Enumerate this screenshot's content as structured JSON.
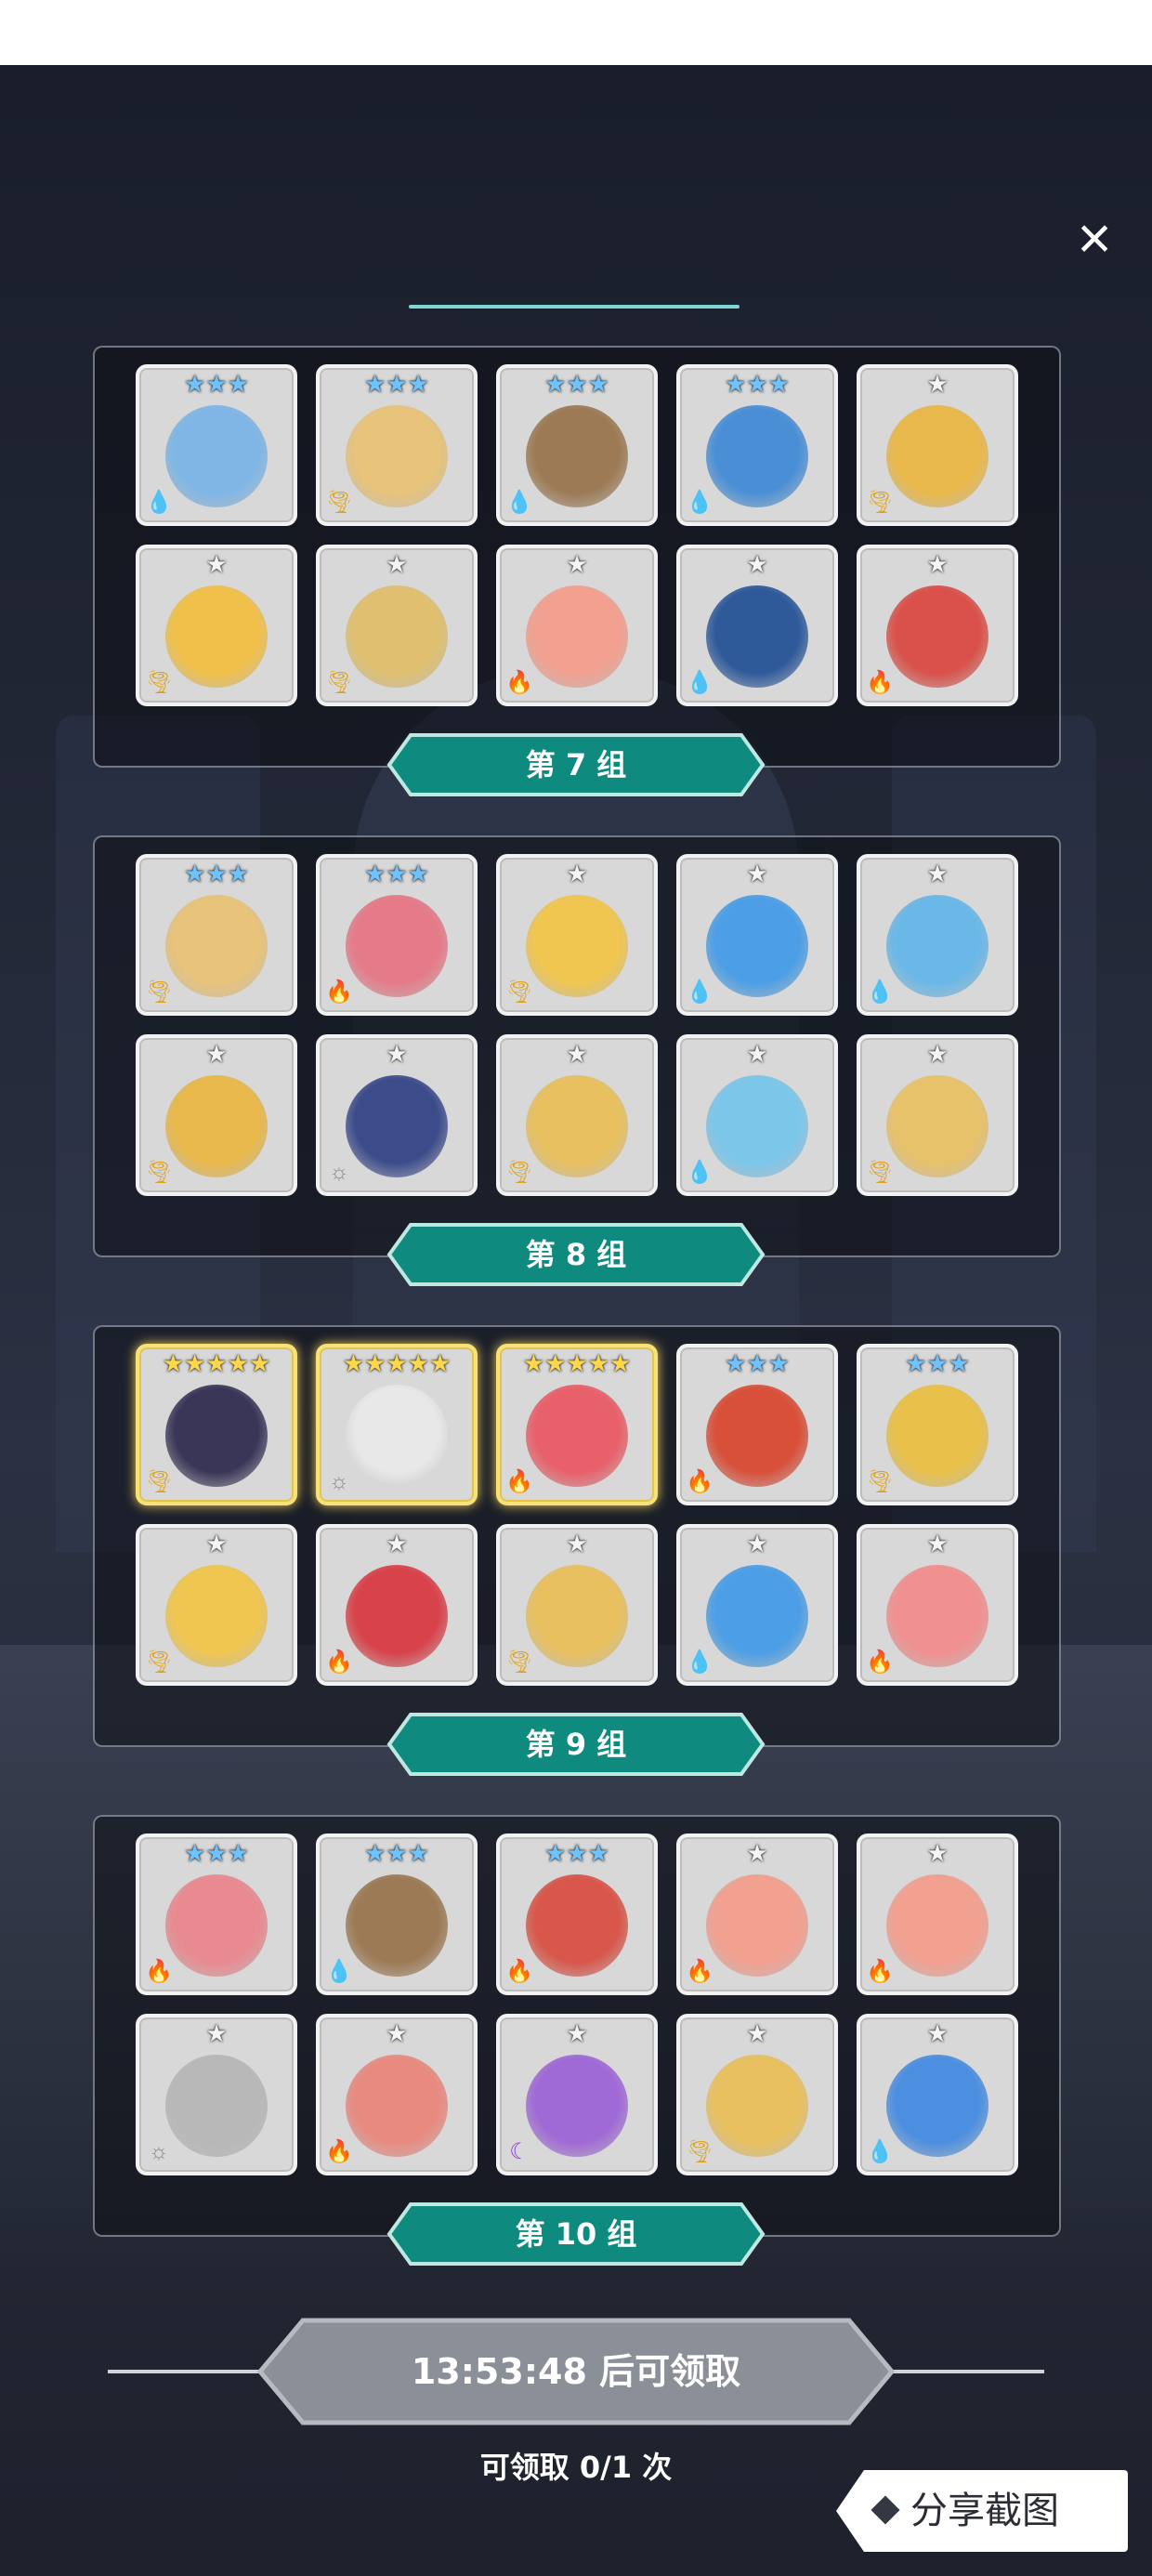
{
  "close_icon": "×",
  "groups": [
    {
      "label": "第 7 组",
      "rows": [
        [
          {
            "stars": "★★★",
            "star_color": "blue",
            "element": "water",
            "element_icon": "💧",
            "tint": "#7fb6e6"
          },
          {
            "stars": "★★★",
            "star_color": "blue",
            "element": "wind",
            "element_icon": "🌪",
            "tint": "#e8c37a"
          },
          {
            "stars": "★★★",
            "star_color": "blue",
            "element": "water",
            "element_icon": "💧",
            "tint": "#9c7a55"
          },
          {
            "stars": "★★★",
            "star_color": "blue",
            "element": "water",
            "element_icon": "💧",
            "tint": "#4a8fd6"
          },
          {
            "stars": "★",
            "star_color": "silver",
            "element": "wind",
            "element_icon": "🌪",
            "tint": "#e9b84a"
          }
        ],
        [
          {
            "stars": "★",
            "star_color": "silver",
            "element": "wind",
            "element_icon": "🌪",
            "tint": "#f0c04a"
          },
          {
            "stars": "★",
            "star_color": "silver",
            "element": "wind",
            "element_icon": "🌪",
            "tint": "#e0c070"
          },
          {
            "stars": "★",
            "star_color": "silver",
            "element": "fire",
            "element_icon": "🔥",
            "tint": "#f2a08f"
          },
          {
            "stars": "★",
            "star_color": "silver",
            "element": "water",
            "element_icon": "💧",
            "tint": "#2f5a9a"
          },
          {
            "stars": "★",
            "star_color": "silver",
            "element": "fire",
            "element_icon": "🔥",
            "tint": "#d9514a"
          }
        ]
      ]
    },
    {
      "label": "第 8 组",
      "rows": [
        [
          {
            "stars": "★★★",
            "star_color": "blue",
            "element": "wind",
            "element_icon": "🌪",
            "tint": "#e8c37a"
          },
          {
            "stars": "★★★",
            "star_color": "blue",
            "element": "fire",
            "element_icon": "🔥",
            "tint": "#e57a88"
          },
          {
            "stars": "★",
            "star_color": "silver",
            "element": "wind",
            "element_icon": "🌪",
            "tint": "#f0c650"
          },
          {
            "stars": "★",
            "star_color": "silver",
            "element": "water",
            "element_icon": "💧",
            "tint": "#4c9ee6"
          },
          {
            "stars": "★",
            "star_color": "silver",
            "element": "water",
            "element_icon": "💧",
            "tint": "#6ab8e8"
          }
        ],
        [
          {
            "stars": "★",
            "star_color": "silver",
            "element": "wind",
            "element_icon": "🌪",
            "tint": "#e8b84a"
          },
          {
            "stars": "★",
            "star_color": "silver",
            "element": "light",
            "element_icon": "☼",
            "tint": "#3c4c8a"
          },
          {
            "stars": "★",
            "star_color": "silver",
            "element": "wind",
            "element_icon": "🌪",
            "tint": "#e8c060"
          },
          {
            "stars": "★",
            "star_color": "silver",
            "element": "water",
            "element_icon": "💧",
            "tint": "#7cc6ea"
          },
          {
            "stars": "★",
            "star_color": "silver",
            "element": "wind",
            "element_icon": "🌪",
            "tint": "#e8c26a"
          }
        ]
      ]
    },
    {
      "label": "第 9 组",
      "rows": [
        [
          {
            "stars": "★★★★★",
            "star_color": "gold",
            "element": "wind",
            "element_icon": "🌪",
            "tint": "#3a3658",
            "gold": true
          },
          {
            "stars": "★★★★★",
            "star_color": "gold",
            "element": "light",
            "element_icon": "☼",
            "tint": "#e8e8e8",
            "gold": true
          },
          {
            "stars": "★★★★★",
            "star_color": "gold",
            "element": "fire",
            "element_icon": "🔥",
            "tint": "#e8606a",
            "gold": true
          },
          {
            "stars": "★★★",
            "star_color": "blue",
            "element": "fire",
            "element_icon": "🔥",
            "tint": "#d8503a"
          },
          {
            "stars": "★★★",
            "star_color": "blue",
            "element": "wind",
            "element_icon": "🌪",
            "tint": "#e8c04a"
          }
        ],
        [
          {
            "stars": "★",
            "star_color": "silver",
            "element": "wind",
            "element_icon": "🌪",
            "tint": "#f0c650"
          },
          {
            "stars": "★",
            "star_color": "silver",
            "element": "fire",
            "element_icon": "🔥",
            "tint": "#d8424a"
          },
          {
            "stars": "★",
            "star_color": "silver",
            "element": "wind",
            "element_icon": "🌪",
            "tint": "#e8c060"
          },
          {
            "stars": "★",
            "star_color": "silver",
            "element": "water",
            "element_icon": "💧",
            "tint": "#4c9ee6"
          },
          {
            "stars": "★",
            "star_color": "silver",
            "element": "fire",
            "element_icon": "🔥",
            "tint": "#f09090"
          }
        ]
      ]
    },
    {
      "label": "第 10 组",
      "rows": [
        [
          {
            "stars": "★★★",
            "star_color": "blue",
            "element": "fire",
            "element_icon": "🔥",
            "tint": "#e88a90"
          },
          {
            "stars": "★★★",
            "star_color": "blue",
            "element": "water",
            "element_icon": "💧",
            "tint": "#9c7a55"
          },
          {
            "stars": "★★★",
            "star_color": "blue",
            "element": "fire",
            "element_icon": "🔥",
            "tint": "#d8564a"
          },
          {
            "stars": "★",
            "star_color": "silver",
            "element": "fire",
            "element_icon": "🔥",
            "tint": "#f2a090"
          },
          {
            "stars": "★",
            "star_color": "silver",
            "element": "fire",
            "element_icon": "🔥",
            "tint": "#f2a090"
          }
        ],
        [
          {
            "stars": "★",
            "star_color": "silver",
            "element": "light",
            "element_icon": "☼",
            "tint": "#b8b8b8"
          },
          {
            "stars": "★",
            "star_color": "silver",
            "element": "fire",
            "element_icon": "🔥",
            "tint": "#e88a80"
          },
          {
            "stars": "★",
            "star_color": "silver",
            "element": "dark",
            "element_icon": "☾",
            "tint": "#a06ad6"
          },
          {
            "stars": "★",
            "star_color": "silver",
            "element": "wind",
            "element_icon": "🌪",
            "tint": "#e8c060"
          },
          {
            "stars": "★",
            "star_color": "silver",
            "element": "water",
            "element_icon": "💧",
            "tint": "#4c8ee0"
          }
        ]
      ]
    }
  ],
  "claim": {
    "button_text": "13:53:48 后可领取",
    "count_text": "可领取 0/1 次"
  },
  "share": {
    "label": "分享截图"
  },
  "colors": {
    "label_fill": "#0e8a7e",
    "label_border": "#bfe8e2",
    "claim_fill": "#8b8f98",
    "claim_border": "#b7bac1"
  }
}
